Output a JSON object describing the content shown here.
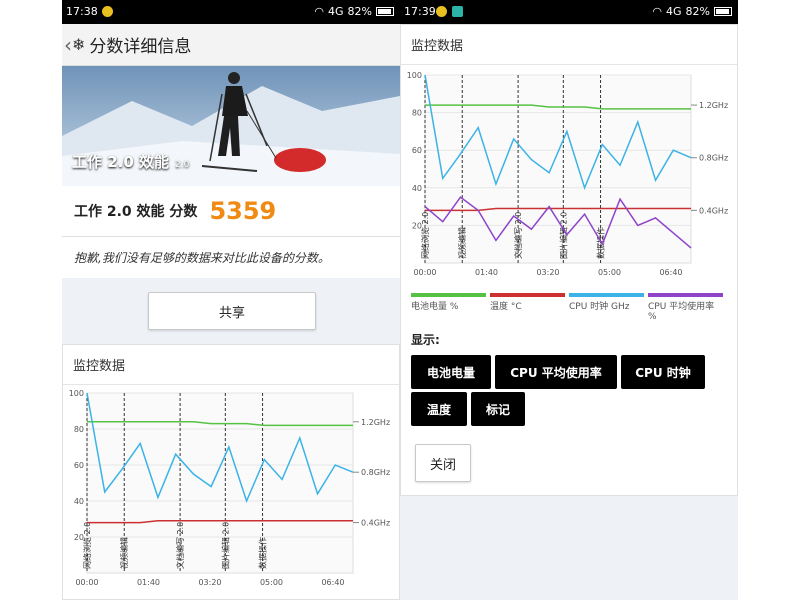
{
  "left": {
    "status": {
      "time": "17:38",
      "network": "4G",
      "battery": "82%"
    },
    "title": "分数详细信息",
    "hero_title": "工作 2.0 效能",
    "hero_version": "2.0",
    "score_label": "工作 2.0 效能 分数",
    "score_value": "5359",
    "message": "抱歉,我们没有足够的数据来对比此设备的分数。",
    "share_label": "共享",
    "monitor_title": "监控数据"
  },
  "right": {
    "status": {
      "time": "17:39",
      "network": "4G",
      "battery": "82%"
    },
    "monitor_title": "监控数据",
    "legend": [
      {
        "label": "电池电量 %",
        "color": "#55c244"
      },
      {
        "label": "温度 °C",
        "color": "#cc3030"
      },
      {
        "label": "CPU 时钟 GHz",
        "color": "#3bb3e6"
      },
      {
        "label": "CPU 平均使用率 %",
        "color": "#8e44c9"
      }
    ],
    "show_label": "显示:",
    "toggles": [
      "电池电量",
      "CPU 平均使用率",
      "CPU 时钟",
      "温度",
      "标记"
    ],
    "close_label": "关闭"
  },
  "chart_data": [
    {
      "type": "line",
      "x_ticks": [
        "00:00",
        "01:40",
        "03:20",
        "05:00",
        "06:40"
      ],
      "y_ticks": [
        20,
        40,
        60,
        80,
        100
      ],
      "ylim": [
        0,
        100
      ],
      "right_ticks": [
        "1.2GHz",
        "0.8GHz",
        "0.4GHz"
      ],
      "markers": [
        "网络浏览 2.0",
        "视频编辑",
        "文档编写 2.0",
        "图片编辑 2.0",
        "数据操作"
      ],
      "series": [
        {
          "name": "电池电量 %",
          "color": "#55c244",
          "values": [
            84,
            84,
            84,
            84,
            84,
            84,
            84,
            83,
            83,
            83,
            82,
            82,
            82,
            82,
            82,
            82
          ]
        },
        {
          "name": "温度 °C",
          "color": "#cc3030",
          "values": [
            28,
            28,
            28,
            28,
            29,
            29,
            29,
            29,
            29,
            29,
            29,
            29,
            29,
            29,
            29,
            29
          ]
        },
        {
          "name": "CPU 时钟 GHz",
          "color": "#3bb3e6",
          "values": [
            100,
            45,
            58,
            72,
            42,
            66,
            55,
            48,
            70,
            40,
            63,
            52,
            75,
            44,
            60,
            56
          ]
        }
      ]
    },
    {
      "type": "line",
      "x_ticks": [
        "00:00",
        "01:40",
        "03:20",
        "05:00",
        "06:40"
      ],
      "y_ticks": [
        20,
        40,
        60,
        80,
        100
      ],
      "ylim": [
        0,
        100
      ],
      "right_ticks": [
        "1.2GHz",
        "0.8GHz",
        "0.4GHz"
      ],
      "markers": [
        "网络浏览 2.0",
        "视频编辑",
        "文档编写 2.0",
        "图片编辑 2.0",
        "数据操作"
      ],
      "series": [
        {
          "name": "电池电量 %",
          "color": "#55c244",
          "values": [
            84,
            84,
            84,
            84,
            84,
            84,
            84,
            83,
            83,
            83,
            82,
            82,
            82,
            82,
            82,
            82
          ]
        },
        {
          "name": "温度 °C",
          "color": "#cc3030",
          "values": [
            28,
            28,
            28,
            28,
            29,
            29,
            29,
            29,
            29,
            29,
            29,
            29,
            29,
            29,
            29,
            29
          ]
        },
        {
          "name": "CPU 时钟 GHz",
          "color": "#3bb3e6",
          "values": [
            100,
            45,
            58,
            72,
            42,
            66,
            55,
            48,
            70,
            40,
            63,
            52,
            75,
            44,
            60,
            56
          ]
        },
        {
          "name": "CPU 平均使用率 %",
          "color": "#8e44c9",
          "values": [
            30,
            22,
            35,
            28,
            12,
            25,
            18,
            30,
            15,
            26,
            10,
            34,
            20,
            24,
            16,
            8
          ]
        }
      ]
    }
  ]
}
